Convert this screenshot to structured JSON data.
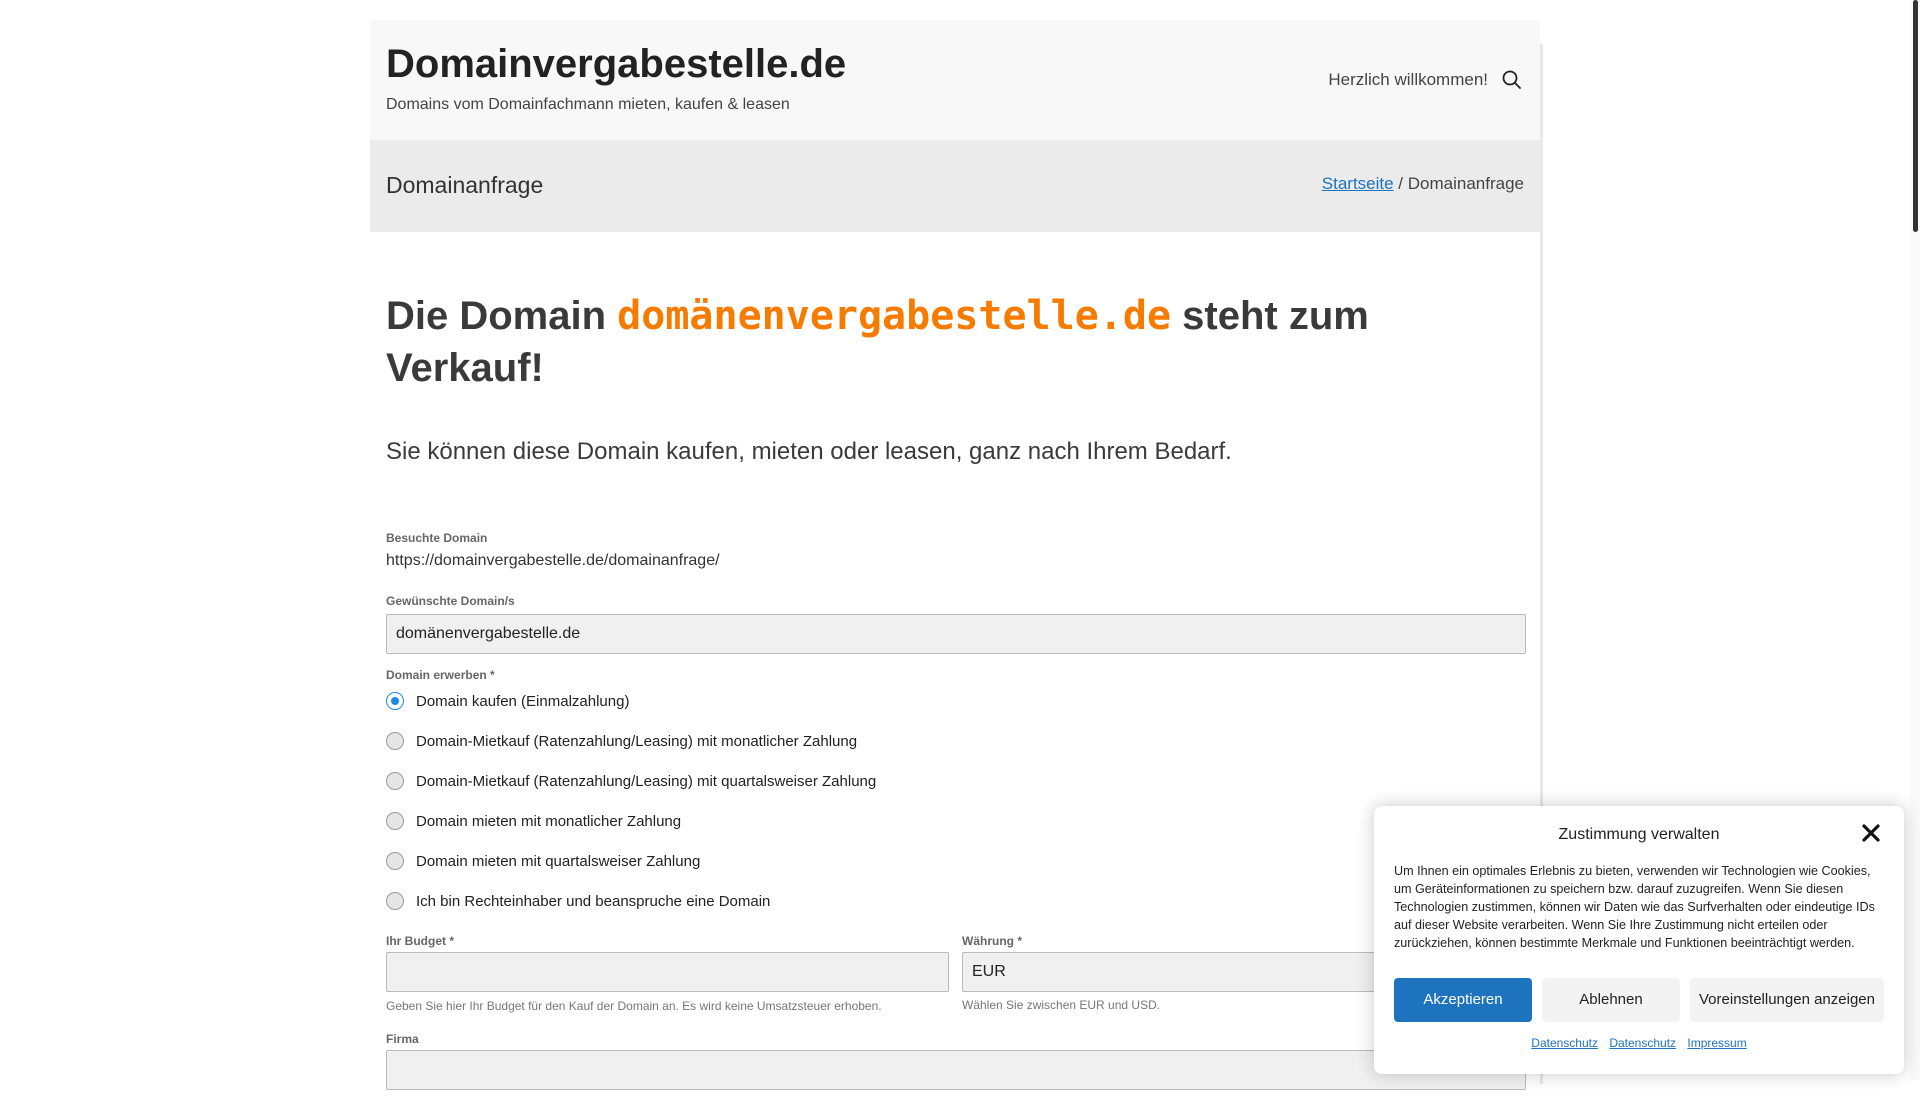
{
  "header": {
    "site_title": "Domainvergabestelle.de",
    "tagline": "Domains vom Domainfachmann mieten, kaufen & leasen",
    "welcome": "Herzlich willkommen!",
    "search_icon": "search-icon"
  },
  "title_bar": {
    "heading": "Domainanfrage",
    "breadcrumb_home": "Startseite",
    "breadcrumb_separator": " / ",
    "breadcrumb_current": "Domainanfrage"
  },
  "main": {
    "headline_prefix": "Die Domain ",
    "headline_domain": "domänenvergabestelle.de",
    "headline_suffix": " steht zum Verkauf!",
    "lead": "Sie können diese Domain kaufen, mieten oder leasen, ganz nach Ihrem Bedarf."
  },
  "form": {
    "searched_label": "Besuchte Domain",
    "searched_value": "https://domainvergabestelle.de/domainanfrage/",
    "wanted_label": "Gewünschte Domain/s",
    "wanted_value": "domänenvergabestelle.de",
    "acquire_label": "Domain erwerben *",
    "options": [
      {
        "label": "Domain kaufen (Einmalzahlung)",
        "checked": true
      },
      {
        "label": "Domain-Mietkauf (Ratenzahlung/Leasing) mit monatlicher Zahlung",
        "checked": false
      },
      {
        "label": "Domain-Mietkauf (Ratenzahlung/Leasing) mit quartalsweiser Zahlung",
        "checked": false
      },
      {
        "label": "Domain mieten mit monatlicher Zahlung",
        "checked": false
      },
      {
        "label": "Domain mieten mit quartalsweiser Zahlung",
        "checked": false
      },
      {
        "label": "Ich bin Rechteinhaber und beanspruche eine Domain",
        "checked": false
      }
    ],
    "budget_label": "Ihr Budget *",
    "budget_value": "",
    "budget_hint": "Geben Sie hier Ihr Budget für den Kauf der Domain an. Es wird keine Umsatzsteuer erhoben.",
    "currency_label": "Währung *",
    "currency_value": "EUR",
    "currency_hint": "Wählen Sie zwischen EUR und USD.",
    "company_label": "Firma",
    "company_value": ""
  },
  "consent": {
    "title": "Zustimmung verwalten",
    "text": "Um Ihnen ein optimales Erlebnis zu bieten, verwenden wir Technologien wie Cookies, um Geräteinformationen zu speichern bzw. darauf zuzugreifen. Wenn Sie diesen Technologien zustimmen, können wir Daten wie das Surfverhalten oder eindeutige IDs auf dieser Website verarbeiten. Wenn Sie Ihre Zustimmung nicht erteilen oder zurückziehen, können bestimmte Merkmale und Funktionen beeinträchtigt werden.",
    "accept": "Akzeptieren",
    "deny": "Ablehnen",
    "preferences": "Voreinstellungen anzeigen",
    "links": [
      "Datenschutz",
      "Datenschutz",
      "Impressum"
    ]
  },
  "colors": {
    "accent": "#1e73be",
    "domain_highlight": "#f57c00",
    "header_bg": "#f8f8f8",
    "title_bar_bg": "#ebebeb"
  }
}
